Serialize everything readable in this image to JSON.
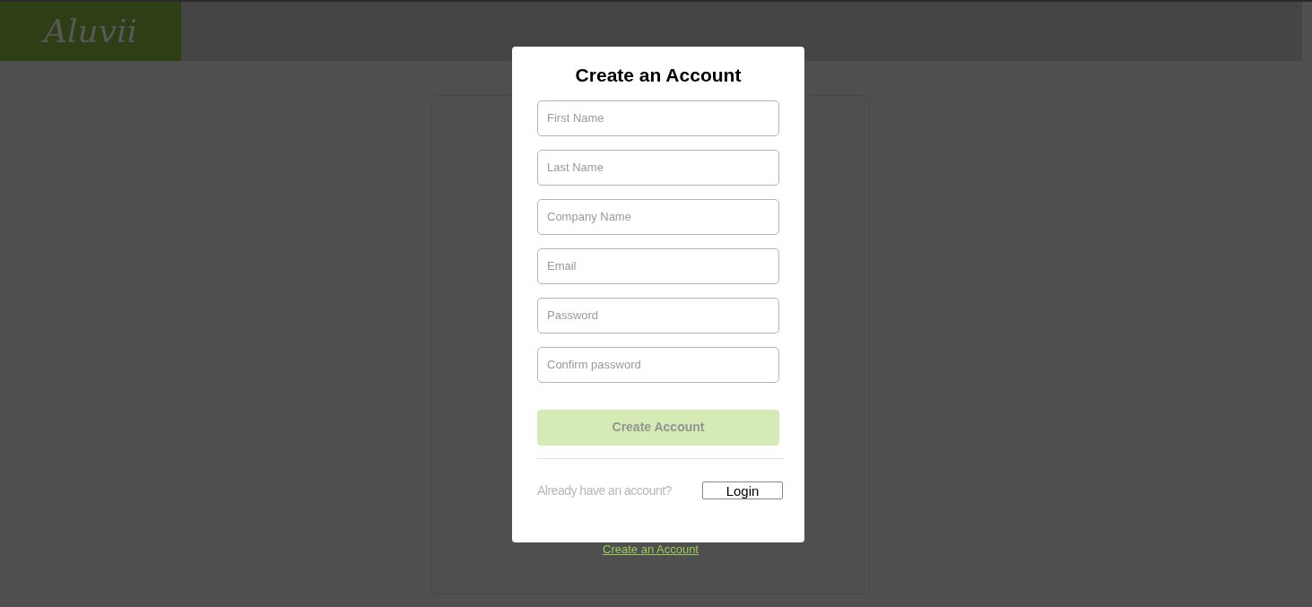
{
  "header": {
    "logo": "Aluvii"
  },
  "background_card": {
    "link": "Create an Account"
  },
  "modal": {
    "title": "Create an Account",
    "fields": [
      {
        "placeholder": "First Name"
      },
      {
        "placeholder": "Last Name"
      },
      {
        "placeholder": "Company Name"
      },
      {
        "placeholder": "Email"
      },
      {
        "placeholder": "Password"
      },
      {
        "placeholder": "Confirm password"
      }
    ],
    "submit": {
      "label": "Create Account",
      "disabled": true
    },
    "footer_text": "Already have an account?",
    "login_button": "Login"
  }
}
